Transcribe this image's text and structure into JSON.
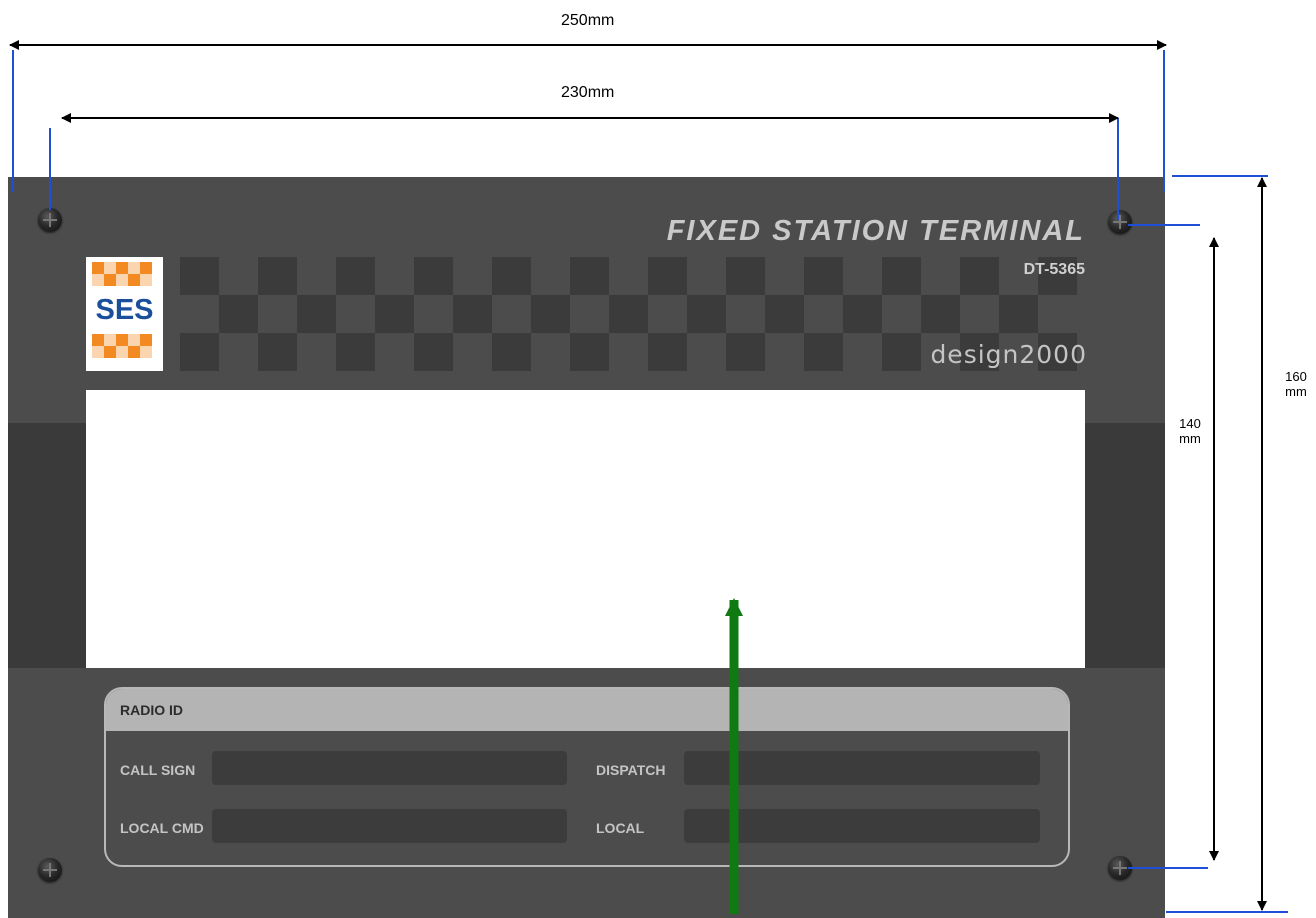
{
  "dimensions": {
    "outer_width": "250mm",
    "inner_width": "230mm",
    "inner_height_value": "140",
    "inner_height_unit": "mm",
    "outer_height_value": "160",
    "outer_height_unit": "mm"
  },
  "panel": {
    "title": "FIXED STATION TERMINAL",
    "model": "DT-5365",
    "brand": "design2000",
    "logo_text": "SES"
  },
  "radio_id": {
    "title": "RADIO ID",
    "fields": [
      {
        "label": "CALL SIGN",
        "value": ""
      },
      {
        "label": "DISPATCH",
        "value": ""
      },
      {
        "label": "LOCAL CMD",
        "value": ""
      },
      {
        "label": "LOCAL",
        "value": ""
      }
    ]
  },
  "colors": {
    "panel": "#4c4c4c",
    "extension_lines": "#1f4fd6",
    "arrow": "#0f7a12",
    "logo_orange": "#f28a21",
    "logo_blue": "#1a4f9c"
  }
}
